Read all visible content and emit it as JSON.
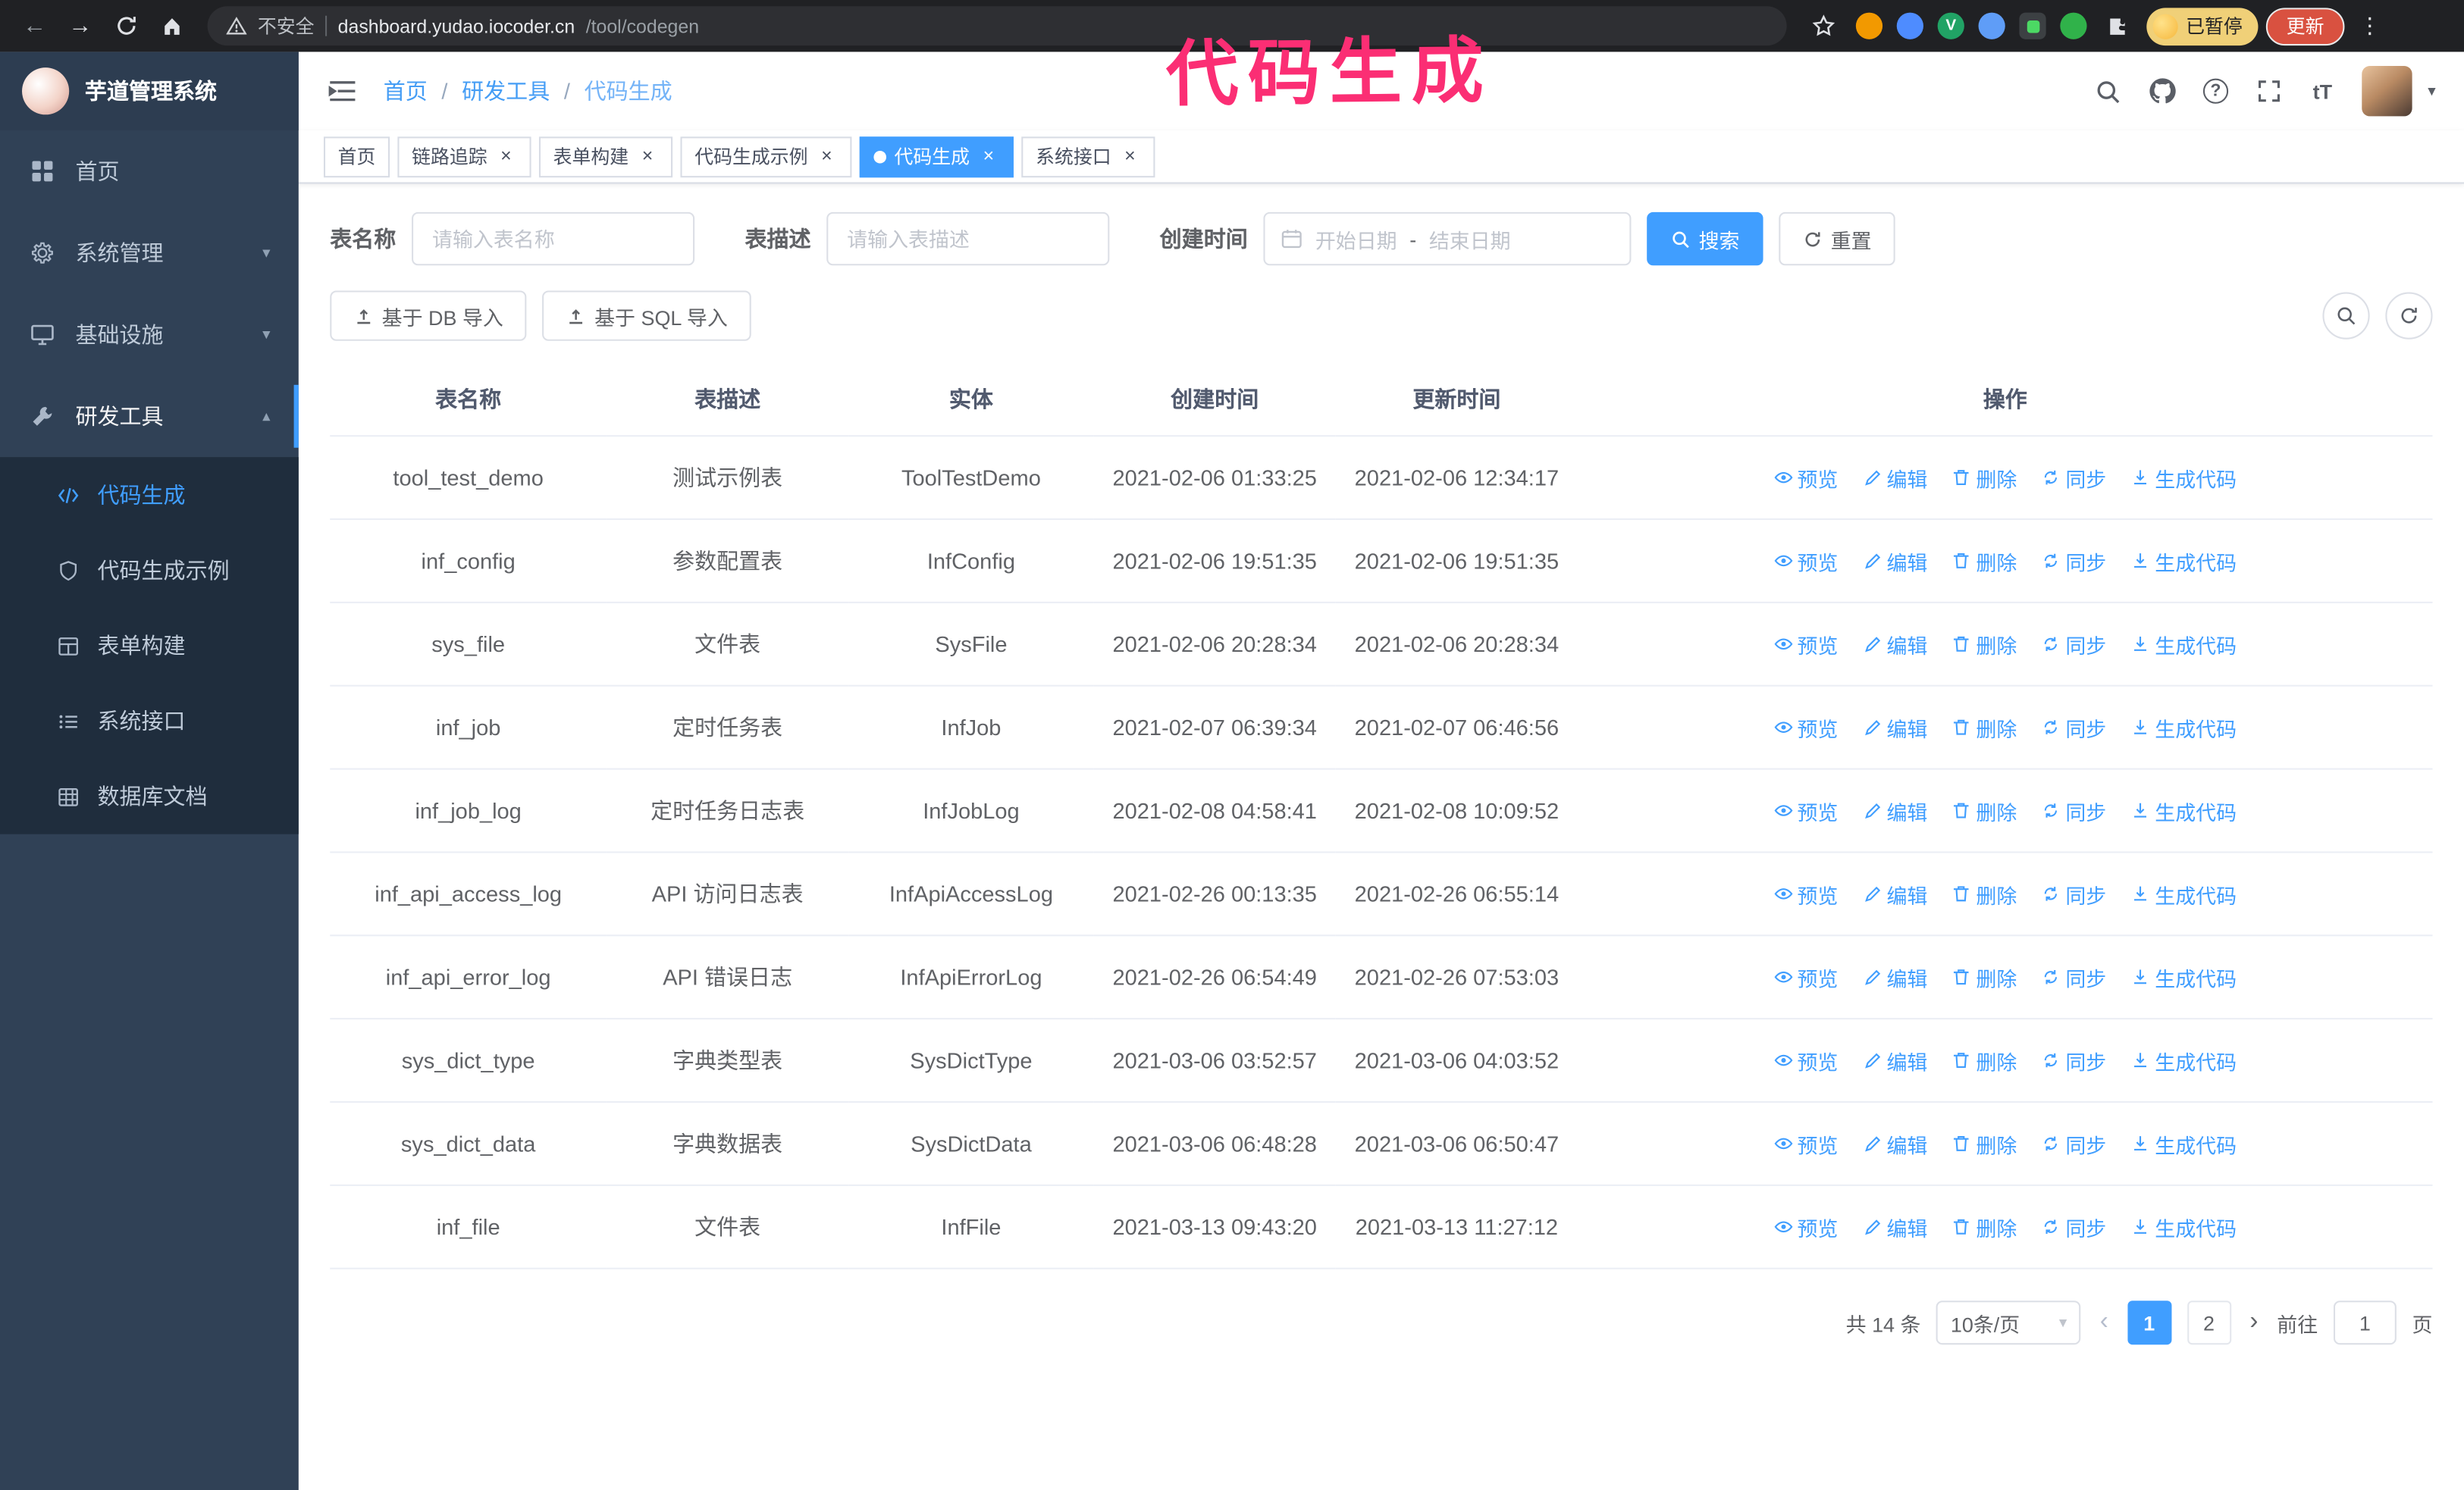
{
  "colors": {
    "accent": "#409eff",
    "sidebar-bg": "#304156",
    "submenu-bg": "#1f2d3d",
    "annotation": "#fb2e74",
    "update-red": "#d95140",
    "chip-yellow": "#f0d078"
  },
  "browser": {
    "security_label": "不安全",
    "url_host": "dashboard.yudao.iocoder.cn",
    "url_path": "/tool/codegen",
    "profile_chip": "已暂停",
    "update_button": "更新",
    "kebab": "⋮",
    "back": "←",
    "forward": "→"
  },
  "annotation": {
    "text": "代码生成"
  },
  "sidebar": {
    "logo_title": "芋道管理系统",
    "items": [
      {
        "label": "首页"
      },
      {
        "label": "系统管理"
      },
      {
        "label": "基础设施"
      },
      {
        "label": "研发工具"
      }
    ],
    "sub_items": [
      {
        "label": "代码生成"
      },
      {
        "label": "代码生成示例"
      },
      {
        "label": "表单构建"
      },
      {
        "label": "系统接口"
      },
      {
        "label": "数据库文档"
      }
    ]
  },
  "header": {
    "breadcrumb": [
      "首页",
      "研发工具",
      "代码生成"
    ],
    "breadcrumb_separator": "/"
  },
  "tabs": [
    {
      "label": "首页",
      "active": false,
      "closable": false
    },
    {
      "label": "链路追踪",
      "active": false,
      "closable": true
    },
    {
      "label": "表单构建",
      "active": false,
      "closable": true
    },
    {
      "label": "代码生成示例",
      "active": false,
      "closable": true
    },
    {
      "label": "代码生成",
      "active": true,
      "closable": true
    },
    {
      "label": "系统接口",
      "active": false,
      "closable": true
    }
  ],
  "filters": {
    "table_name_label": "表名称",
    "table_name_placeholder": "请输入表名称",
    "table_desc_label": "表描述",
    "table_desc_placeholder": "请输入表描述",
    "create_time_label": "创建时间",
    "date_start_placeholder": "开始日期",
    "date_separator": "-",
    "date_end_placeholder": "结束日期",
    "search_button": "搜索",
    "reset_button": "重置"
  },
  "toolbar": {
    "import_db_button": "基于 DB 导入",
    "import_sql_button": "基于 SQL 导入"
  },
  "table": {
    "columns": [
      "表名称",
      "表描述",
      "实体",
      "创建时间",
      "更新时间",
      "操作"
    ],
    "actions": [
      "预览",
      "编辑",
      "删除",
      "同步",
      "生成代码"
    ],
    "rows": [
      {
        "name": "tool_test_demo",
        "desc": "测试示例表",
        "entity": "ToolTestDemo",
        "created": "2021-02-06 01:33:25",
        "updated": "2021-02-06 12:34:17"
      },
      {
        "name": "inf_config",
        "desc": "参数配置表",
        "entity": "InfConfig",
        "created": "2021-02-06 19:51:35",
        "updated": "2021-02-06 19:51:35"
      },
      {
        "name": "sys_file",
        "desc": "文件表",
        "entity": "SysFile",
        "created": "2021-02-06 20:28:34",
        "updated": "2021-02-06 20:28:34"
      },
      {
        "name": "inf_job",
        "desc": "定时任务表",
        "entity": "InfJob",
        "created": "2021-02-07 06:39:34",
        "updated": "2021-02-07 06:46:56"
      },
      {
        "name": "inf_job_log",
        "desc": "定时任务日志表",
        "entity": "InfJobLog",
        "created": "2021-02-08 04:58:41",
        "updated": "2021-02-08 10:09:52"
      },
      {
        "name": "inf_api_access_log",
        "desc": "API 访问日志表",
        "entity": "InfApiAccessLog",
        "created": "2021-02-26 00:13:35",
        "updated": "2021-02-26 06:55:14"
      },
      {
        "name": "inf_api_error_log",
        "desc": "API 错误日志",
        "entity": "InfApiErrorLog",
        "created": "2021-02-26 06:54:49",
        "updated": "2021-02-26 07:53:03"
      },
      {
        "name": "sys_dict_type",
        "desc": "字典类型表",
        "entity": "SysDictType",
        "created": "2021-03-06 03:52:57",
        "updated": "2021-03-06 04:03:52"
      },
      {
        "name": "sys_dict_data",
        "desc": "字典数据表",
        "entity": "SysDictData",
        "created": "2021-03-06 06:48:28",
        "updated": "2021-03-06 06:50:47"
      },
      {
        "name": "inf_file",
        "desc": "文件表",
        "entity": "InfFile",
        "created": "2021-03-13 09:43:20",
        "updated": "2021-03-13 11:27:12"
      }
    ]
  },
  "pagination": {
    "total": "共 14 条",
    "page_size": "10条/页",
    "pages": [
      "1",
      "2"
    ],
    "goto_label": "前往",
    "goto_value": "1",
    "page_label": "页"
  }
}
